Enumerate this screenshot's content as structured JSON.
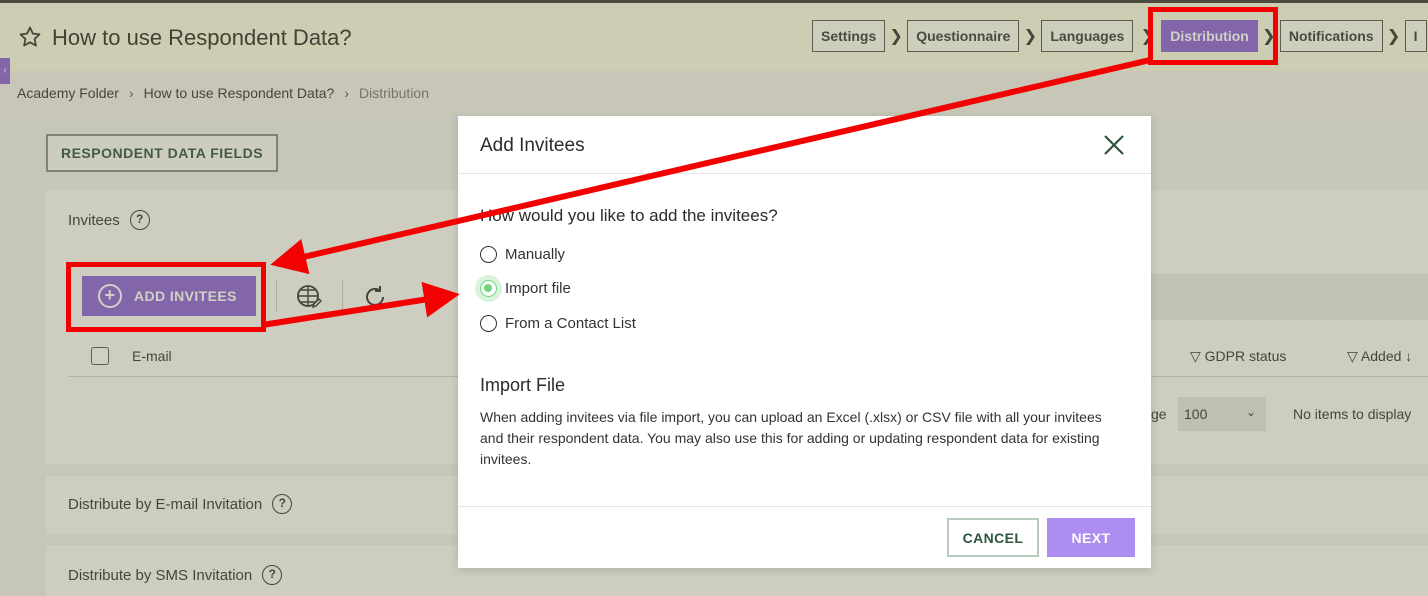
{
  "header": {
    "title": "How to use Respondent Data?",
    "steps": [
      "Settings",
      "Questionnaire",
      "Languages",
      "Distribution",
      "Notifications",
      "I"
    ],
    "active_step": "Distribution"
  },
  "breadcrumb": [
    "Academy Folder",
    "How to use Respondent Data?",
    "Distribution"
  ],
  "main": {
    "respondent_fields_label": "RESPONDENT DATA FIELDS",
    "invitees_title": "Invitees",
    "add_invitees_label": "ADD INVITEES",
    "grid": {
      "col_email": "E-mail",
      "col_gdpr": "GDPR status",
      "col_added": "Added",
      "per_page_label": "ge",
      "per_page_value": "100",
      "no_items": "No items to display"
    },
    "email_section": "Distribute by E-mail Invitation",
    "sms_section": "Distribute by SMS Invitation"
  },
  "modal": {
    "title": "Add Invitees",
    "question": "How would you like to add the invitees?",
    "options": [
      "Manually",
      "Import file",
      "From a Contact List"
    ],
    "selected_option": "Import file",
    "section_title": "Import File",
    "description": "When adding invitees via file import, you can upload an Excel (.xlsx) or CSV file with all your invitees and their respondent data. You may also use this for adding or updating respondent data for existing invitees.",
    "cancel_label": "CANCEL",
    "next_label": "NEXT"
  },
  "colors": {
    "accent": "#8d63d8",
    "annotation": "#f30000",
    "radio_selected": "#6fd67c"
  }
}
